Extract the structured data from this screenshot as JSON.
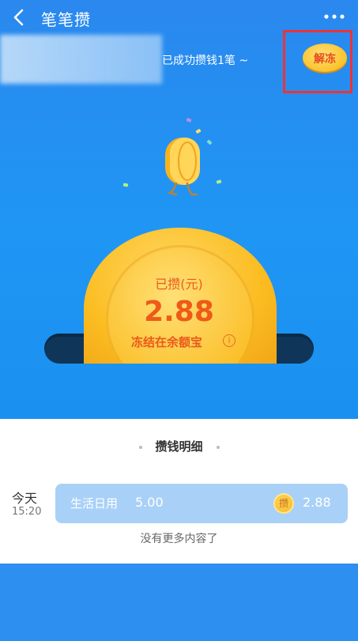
{
  "header": {
    "title": "笔笔攒"
  },
  "banner": {
    "success_message": "已成功攒钱1笔 ~",
    "unfreeze_label": "解冻"
  },
  "summary": {
    "saved_label": "已攒(元)",
    "saved_amount": "2.88",
    "frozen_label": "冻结在余额宝",
    "info_glyph": "i"
  },
  "details": {
    "title": "攒钱明细",
    "records": [
      {
        "day": "今天",
        "time": "15:20",
        "category": "生活日用",
        "amount": "5.00",
        "coin_label": "攒",
        "saved": "2.88"
      }
    ],
    "footer": "没有更多内容了"
  },
  "colors": {
    "header_bg": "#2a88ee",
    "coin_gold": "#fbbd22",
    "coin_text": "#ef5a18",
    "highlight_red": "#ee3333",
    "record_bg": "#a9d1f8"
  }
}
